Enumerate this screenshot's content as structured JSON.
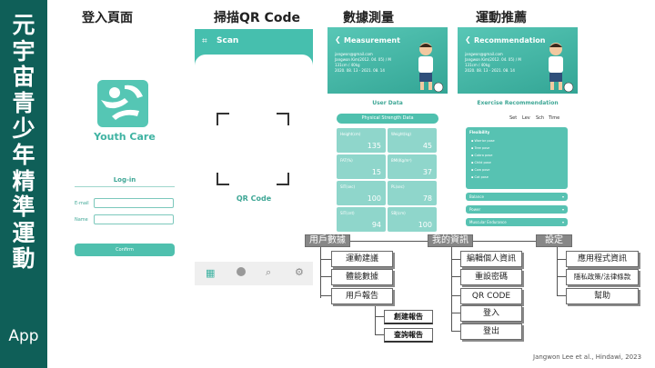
{
  "side_title": {
    "chars": [
      "元",
      "宇",
      "宙",
      "青",
      "少",
      "年",
      "精",
      "準",
      "運",
      "動"
    ],
    "app": "App"
  },
  "sections": {
    "login": "登入頁面",
    "scan": "掃描QR Code",
    "measure": "數據測量",
    "recommend": "運動推薦"
  },
  "login": {
    "brand": "Youth Care",
    "heading": "Log-in",
    "email_label": "E-mail",
    "name_label": "Name",
    "confirm": "Confirm"
  },
  "scan": {
    "title": "Scan",
    "qr_label": "QR Code"
  },
  "measurement": {
    "title": "Measurement",
    "info": [
      "jangwon@gmail.com",
      "Jangwon Kim(2012. 04. 05) / M",
      "131cm / 40kg",
      "2020. 08. 13 - 2021. 08. 14"
    ],
    "section": "User Data",
    "pill": "Physical Strength Data",
    "cells": [
      {
        "label": "Height(cm)",
        "value": "135"
      },
      {
        "label": "Weight(kg)",
        "value": "45"
      },
      {
        "label": "FAT(%)",
        "value": "15"
      },
      {
        "label": "BMI(Kg/m²)",
        "value": "37"
      },
      {
        "label": "SIT(sec)",
        "value": "100"
      },
      {
        "label": "PL(sec)",
        "value": "78"
      },
      {
        "label": "SIT(cnt)",
        "value": "94"
      },
      {
        "label": "SBJ(cm)",
        "value": "100"
      }
    ]
  },
  "recommend": {
    "title": "Recommendation",
    "info": [
      "jangwon@gmail.com",
      "Jangwon Kim(2012. 04. 05) / M",
      "131cm / 40kg",
      "2020. 08. 13 - 2021. 08. 14"
    ],
    "section": "Exercise Recommendation",
    "cols": [
      "Set",
      "Lev",
      "Sch",
      "Time"
    ],
    "panel_title": "Flexibility",
    "items": [
      "Warrior pose",
      "Tree pose",
      "Cobra pose",
      "Child pose",
      "Cow pose",
      "Cat pose"
    ],
    "dropdowns": [
      "Balance",
      "Power",
      "Muscular Endurance"
    ]
  },
  "tree": {
    "roots": [
      "用戶數據",
      "我的資訊",
      "設定"
    ],
    "user_children": [
      "運動建議",
      "體能數據",
      "用戶報告"
    ],
    "report_children": [
      "創建報告",
      "查詢報告"
    ],
    "info_children": [
      "編輯個人資訊",
      "重設密碼",
      "QR CODE",
      "登入",
      "登出"
    ],
    "settings_children": [
      "應用程式資訊",
      "隱私政策/法律條款",
      "幫助"
    ]
  },
  "citation": "Jangwon Lee et al., Hindawi, 2023",
  "colors": {
    "teal": "#3fb3a2",
    "sidebar": "#0f5f58"
  }
}
